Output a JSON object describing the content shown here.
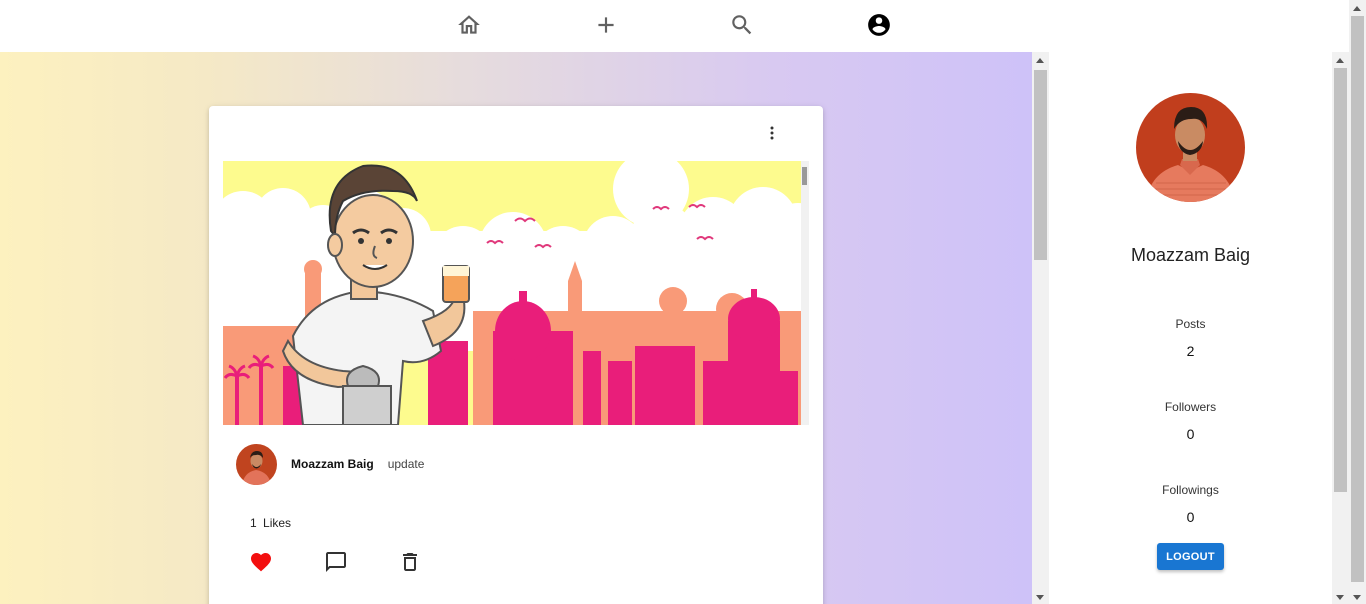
{
  "nav": {
    "icons": [
      "home-icon",
      "add-icon",
      "search-icon",
      "account-circle-icon"
    ]
  },
  "post": {
    "author": "Moazzam Baig",
    "caption": "update",
    "likes_count": "1",
    "likes_label": "Likes",
    "liked": true,
    "icons": {
      "more": "more-vert-icon",
      "like": "heart-icon",
      "comment": "comment-icon",
      "delete": "trash-icon"
    }
  },
  "profile": {
    "name": "Moazzam Baig",
    "posts_label": "Posts",
    "posts_value": "2",
    "followers_label": "Followers",
    "followers_value": "0",
    "followings_label": "Followings",
    "followings_value": "0",
    "logout_label": "LOGOUT"
  },
  "colors": {
    "accent": "#1976d2",
    "like": "#e51c23",
    "gradient_start": "#fdf1bf",
    "gradient_end": "#cec2f8"
  }
}
